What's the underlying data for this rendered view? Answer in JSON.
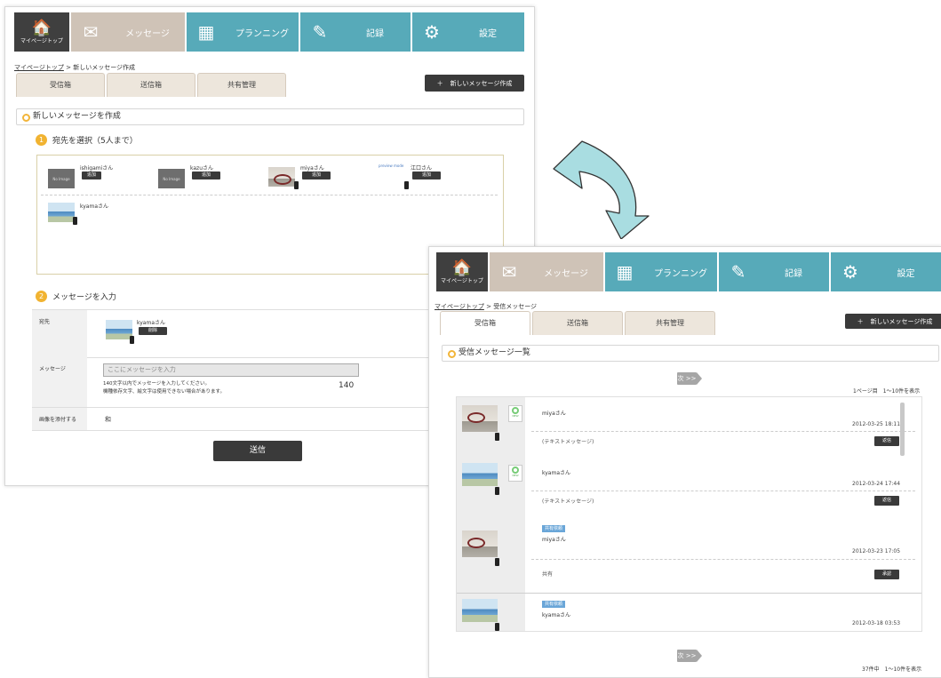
{
  "nav": {
    "home": "マイページトップ",
    "message": "メッセージ",
    "planning": "プランニング",
    "record": "記録",
    "settings": "設定"
  },
  "compose": {
    "breadcrumb_link": "マイページトップ",
    "breadcrumb_current": " > 新しいメッセージ作成",
    "tabs": [
      "受信箱",
      "送信箱",
      "共有管理"
    ],
    "new_message_button": "新しいメッセージ作成",
    "section_title": "新しいメッセージを作成",
    "step1_number": "1",
    "step1_title": "宛先を選択（5人まで）",
    "step2_number": "2",
    "step2_title": "メッセージを入力",
    "recipients": [
      {
        "name": "ishigamiさん",
        "button": "追加",
        "thumb_text": "No Image"
      },
      {
        "name": "kazuさん",
        "button": "追加",
        "thumb_text": "No Image"
      },
      {
        "name": "miyaさん",
        "button": "追加"
      },
      {
        "name": "江口さん",
        "button": "追加",
        "thumb_text": "preview mode"
      },
      {
        "name": "kyamaさん"
      }
    ],
    "to_label": "宛先",
    "to_name": "kyamaさん",
    "to_button": "削除",
    "message_label": "メッセージ",
    "message_placeholder": "ここにメッセージを入力",
    "note_line1": "140文字以内でメッセージを入力してください。",
    "note_line2": "機種依存文字、絵文字は使用できない場合があります。",
    "counter": "140",
    "attach_label": "画像を添付する",
    "attach_value": "和",
    "send_button": "送信"
  },
  "inbox": {
    "breadcrumb_link": "マイページトップ",
    "breadcrumb_current": " > 受信メッセージ",
    "tabs": [
      "受信箱",
      "送信箱",
      "共有管理"
    ],
    "new_message_button": "新しいメッセージ作成",
    "section_title": "受信メッセージ一覧",
    "next_button": "次 >>",
    "pager_top": "1ページ目　1～10件を表示",
    "pager_bottom": "37件中　1～10件を表示",
    "messages": [
      {
        "name": "miyaさん",
        "date": "2012-03-25 18:11",
        "snippet": "(テキストメッセージ)",
        "new": "NEW",
        "reply": "返信"
      },
      {
        "name": "kyamaさん",
        "date": "2012-03-24 17:44",
        "snippet": "(テキストメッセージ)",
        "new": "NEW",
        "reply": "返信"
      },
      {
        "name": "miyaさん",
        "tag": "共有依頼",
        "date": "2012-03-23 17:05",
        "snippet": "共有",
        "reply": "承認"
      },
      {
        "name": "kyamaさん",
        "tag": "共有依頼",
        "date": "2012-03-18 03:53"
      }
    ]
  },
  "colors": {
    "nav_dark": "#3f3f3f",
    "nav_message": "#cfc3b7",
    "nav_teal": "#57aab9",
    "step_orange": "#f1b331",
    "arrow_fill": "#a9dde1"
  }
}
